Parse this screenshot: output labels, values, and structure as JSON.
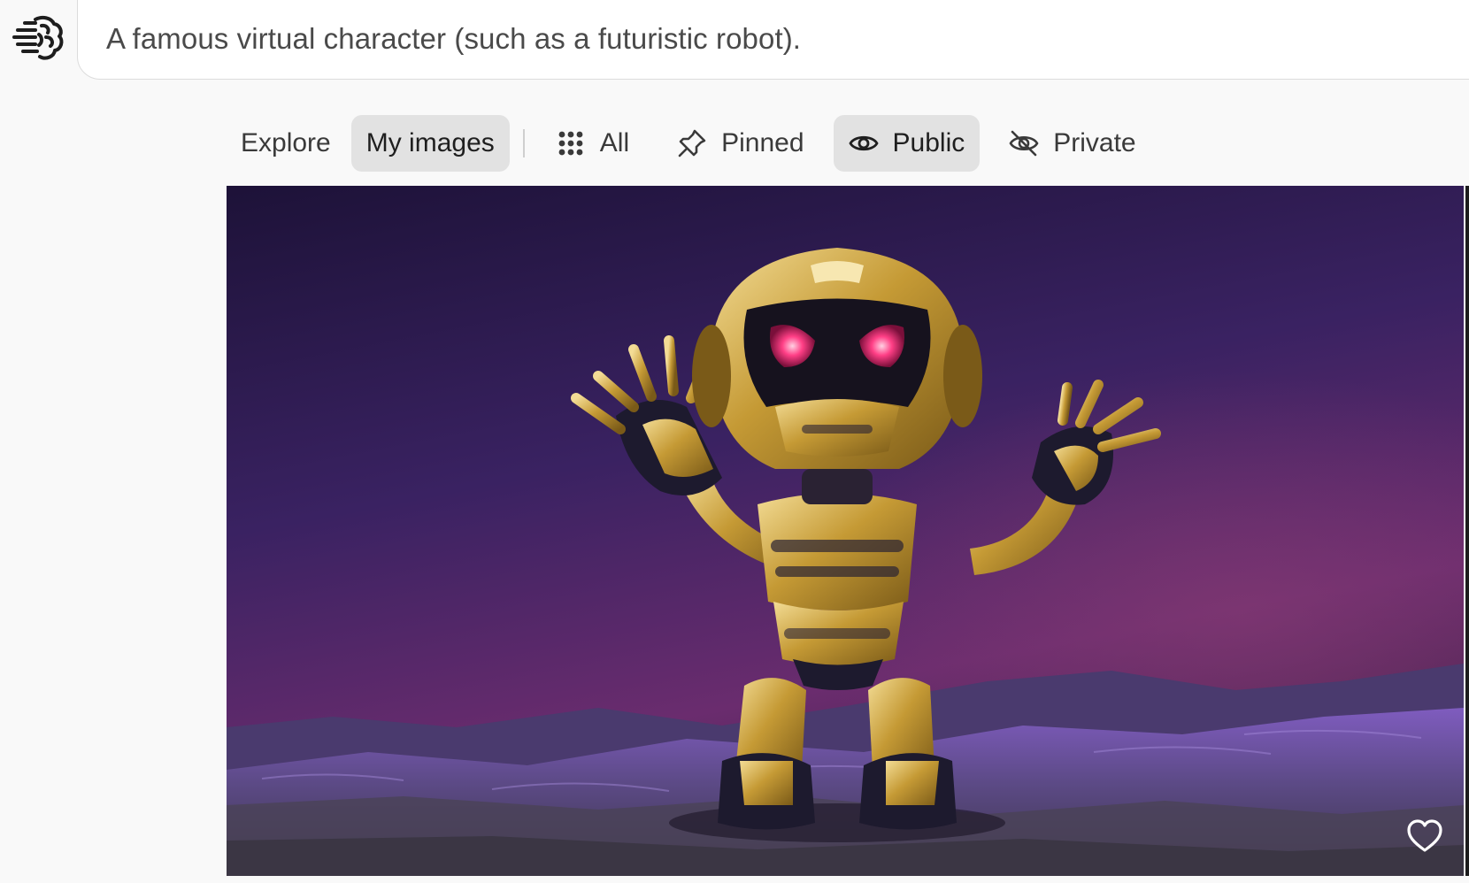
{
  "app": {
    "logo_icon": "brain-logo-icon"
  },
  "prompt": {
    "text": "A famous virtual character (such as a futuristic robot)."
  },
  "filters": {
    "explore": {
      "label": "Explore",
      "active": false
    },
    "my_images": {
      "label": "My images",
      "active": true
    },
    "all": {
      "label": "All",
      "icon": "grid-dots-icon",
      "active": false
    },
    "pinned": {
      "label": "Pinned",
      "icon": "pin-icon",
      "active": false
    },
    "public": {
      "label": "Public",
      "icon": "eye-icon",
      "active": true
    },
    "private": {
      "label": "Private",
      "icon": "eye-off-icon",
      "active": false
    }
  },
  "gallery": {
    "image": {
      "subject": "golden robot with glowing red eyes on purple rocky terrain",
      "favorite_icon": "heart-icon"
    }
  },
  "colors": {
    "page_bg": "#f9f9f9",
    "active_chip_bg": "#e2e2e2",
    "robot_gold": "#c9a13b",
    "robot_eyes": "#ff2d6f",
    "scene_sky": "#3b2260"
  }
}
